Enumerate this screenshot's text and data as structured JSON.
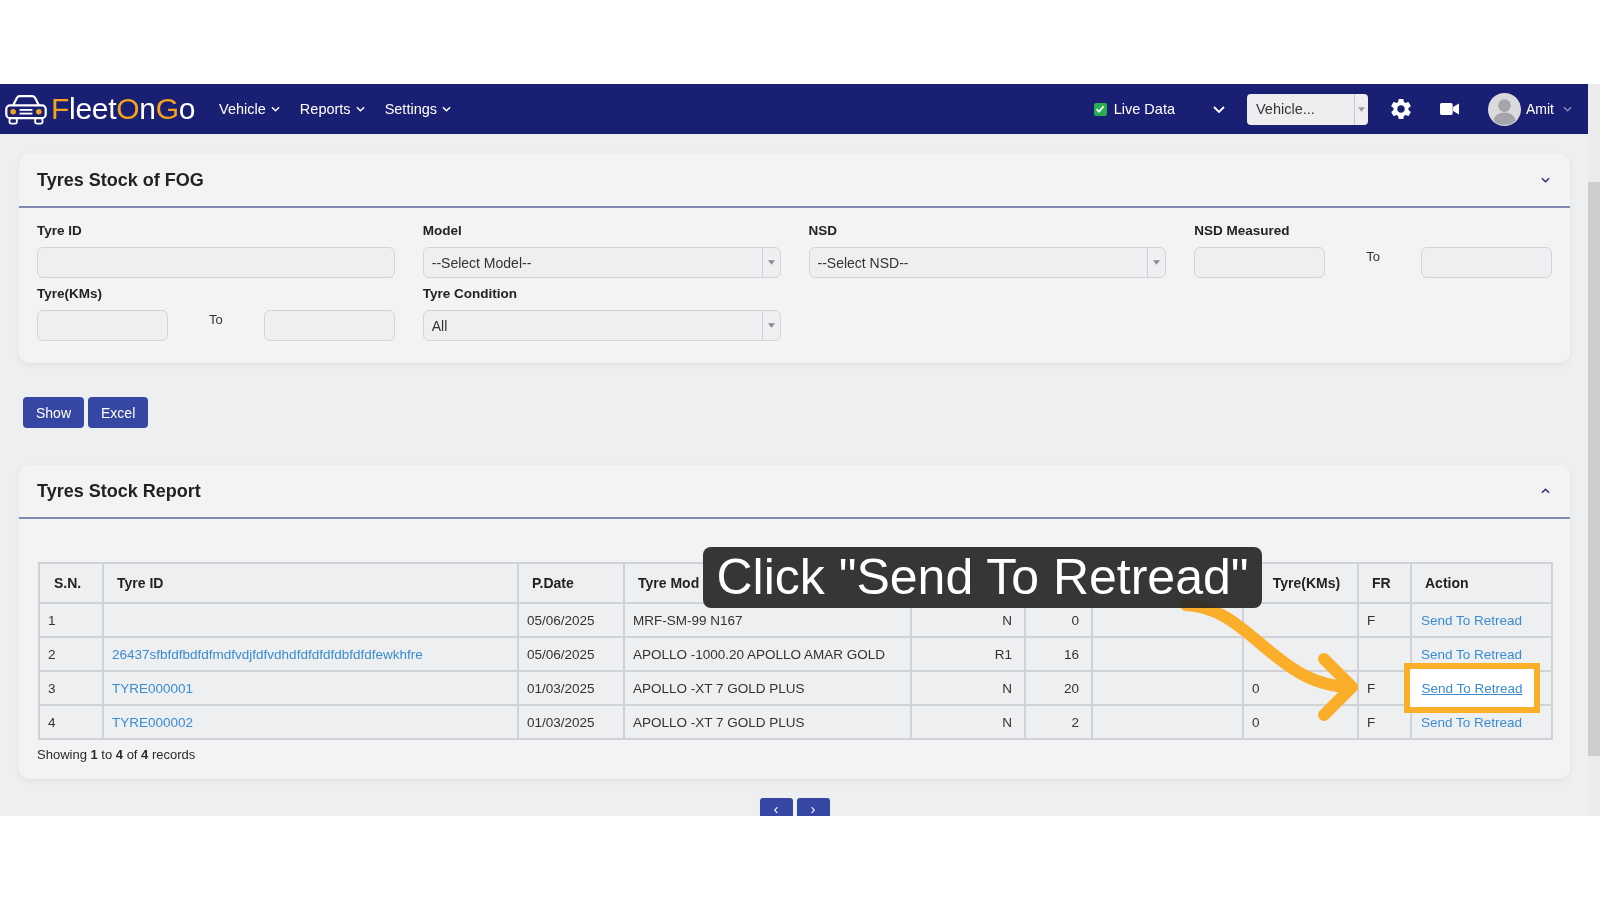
{
  "nav": {
    "logo": [
      {
        "text": "F",
        "color": "#f6a31c"
      },
      {
        "text": "leet",
        "color": "#ffffff"
      },
      {
        "text": "O",
        "color": "#f6a31c"
      },
      {
        "text": "n",
        "color": "#ffffff"
      },
      {
        "text": "G",
        "color": "#f6a31c"
      },
      {
        "text": "o",
        "color": "#ffffff"
      }
    ],
    "menus": [
      "Vehicle",
      "Reports",
      "Settings"
    ],
    "live_data": {
      "label": "Live Data",
      "checked": true
    },
    "vehicle_select": {
      "value": "Vehicle..."
    },
    "user": {
      "name": "Amit"
    }
  },
  "filter_panel": {
    "title": "Tyres Stock of FOG",
    "fields": [
      {
        "kind": "input",
        "label": "Tyre ID"
      },
      {
        "kind": "select",
        "label": "Model",
        "value": "--Select Model--"
      },
      {
        "kind": "select",
        "label": "NSD",
        "value": "--Select NSD--"
      },
      {
        "kind": "range",
        "label": "NSD Measured",
        "separator": "To"
      },
      {
        "kind": "range",
        "label": "Tyre(KMs)",
        "separator": "To"
      },
      {
        "kind": "select",
        "label": "Tyre Condition",
        "value": "All"
      }
    ]
  },
  "buttons": [
    "Show",
    "Excel"
  ],
  "report_panel": {
    "title": "Tyres Stock Report",
    "table": {
      "columns": {
        "sn": "S.N.",
        "tyre_id": "Tyre ID",
        "p_date": "P.Date",
        "tyre_model": "Tyre Mod",
        "tyre_kms": "Tyre(KMs)",
        "fr": "FR",
        "action": "Action"
      },
      "rows": [
        {
          "sn": "1",
          "p_date": "05/06/2025",
          "tyre_model": "MRF-SM-99 N167",
          "column_5": "N",
          "column_6": "0",
          "fr": "F",
          "action": "Send To Retread",
          "highlighted": false
        },
        {
          "sn": "2",
          "tyre_id": "26437sfbfdfbdfdfmdfvdjfdfvdhdfdfdfdfdbfdfdfewkhfre",
          "p_date": "05/06/2025",
          "tyre_model": "APOLLO -1000.20 APOLLO AMAR GOLD",
          "column_5": "R1",
          "column_6": "16",
          "action": "Send To Retread",
          "highlighted": false
        },
        {
          "sn": "3",
          "tyre_id": "TYRE000001",
          "p_date": "01/03/2025",
          "tyre_model": "APOLLO -XT 7 GOLD PLUS",
          "column_5": "N",
          "column_6": "20",
          "tyre_kms": "0",
          "fr": "F",
          "action": "Send To Retread",
          "highlighted": true
        },
        {
          "sn": "4",
          "tyre_id": "TYRE000002",
          "p_date": "01/03/2025",
          "tyre_model": "APOLLO -XT 7 GOLD PLUS",
          "column_5": "N",
          "column_6": "2",
          "tyre_kms": "0",
          "fr": "F",
          "action": "Send To Retread",
          "highlighted": false
        }
      ]
    },
    "summary": "Showing **1** to **4** of **4** records",
    "pagination": [
      "‹",
      "›"
    ]
  },
  "callout": {
    "text": "Click \"Send To Retread\""
  }
}
